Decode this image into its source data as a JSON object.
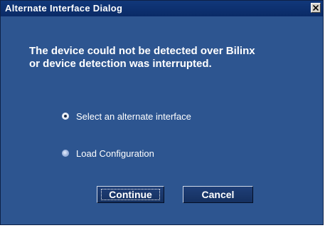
{
  "dialog": {
    "title": "Alternate Interface Dialog",
    "close_icon": "close-icon",
    "message_lines": [
      "The device could not be detected over Bilinx",
      "or device detection was interrupted."
    ],
    "options": [
      {
        "label": "Select an alternate interface",
        "selected": true
      },
      {
        "label": "Load Configuration",
        "selected": false
      }
    ],
    "buttons": {
      "continue_label": "Continue",
      "cancel_label": "Cancel"
    }
  },
  "colors": {
    "background": "#2d5590",
    "titlebar": "#0a2a66",
    "text": "#ffffff"
  }
}
